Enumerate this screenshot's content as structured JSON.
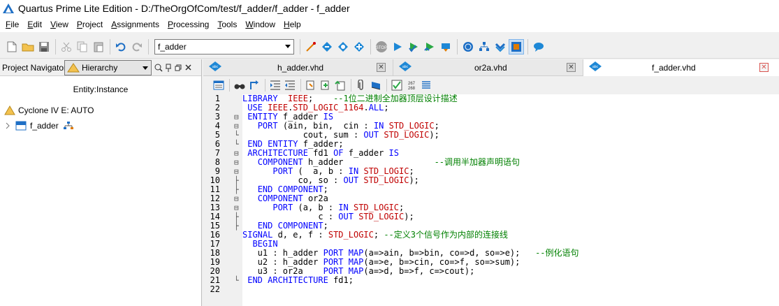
{
  "window": {
    "title": "Quartus Prime Lite Edition - D:/TheOrgOfCom/test/f_adder/f_adder - f_adder"
  },
  "menu": [
    {
      "label": "File",
      "u": "F",
      "rest": "ile"
    },
    {
      "label": "Edit",
      "u": "E",
      "rest": "dit"
    },
    {
      "label": "View",
      "u": "V",
      "rest": "iew"
    },
    {
      "label": "Project",
      "u": "P",
      "rest": "roject"
    },
    {
      "label": "Assignments",
      "u": "A",
      "rest": "ssignments"
    },
    {
      "label": "Processing",
      "u": "P",
      "rest": "rocessing"
    },
    {
      "label": "Tools",
      "u": "T",
      "rest": "ools"
    },
    {
      "label": "Window",
      "u": "W",
      "rest": "indow"
    },
    {
      "label": "Help",
      "u": "H",
      "rest": "elp"
    }
  ],
  "toolbar": {
    "entity_combo": "f_adder"
  },
  "left_panel": {
    "title": "Project Navigator",
    "view_combo": "Hierarchy",
    "column_header": "Entity:Instance",
    "device": "Cyclone IV E: AUTO",
    "entity": "f_adder",
    "entity_icon_label": "abc"
  },
  "tabs": [
    {
      "label": "h_adder.vhd",
      "icon": "abc",
      "active": false
    },
    {
      "label": "or2a.vhd",
      "icon": "abc",
      "active": false
    },
    {
      "label": "f_adder.vhd",
      "icon": "abc",
      "active": true
    }
  ],
  "editor_toolbar": {
    "line_count_label_top": "267",
    "line_count_label_bottom": "268"
  },
  "code": {
    "line_numbers": [
      "1",
      "2",
      "3",
      "4",
      "5",
      "6",
      "7",
      "8",
      "9",
      "10",
      "11",
      "12",
      "13",
      "14",
      "15",
      "16",
      "17",
      "18",
      "19",
      "20",
      "21",
      "22"
    ],
    "lines": [
      [
        {
          "t": "LIBRARY",
          "c": "kw"
        },
        {
          "t": "  "
        },
        {
          "t": "IEEE",
          "c": "ty"
        },
        {
          "t": ";    "
        },
        {
          "t": "--1位二进制全加器顶层设计描述",
          "c": "cm"
        }
      ],
      [
        {
          "t": " "
        },
        {
          "t": "USE",
          "c": "kw"
        },
        {
          "t": " "
        },
        {
          "t": "IEEE",
          "c": "ty"
        },
        {
          "t": "."
        },
        {
          "t": "STD_LOGIC_1164",
          "c": "ty"
        },
        {
          "t": "."
        },
        {
          "t": "ALL",
          "c": "kw"
        },
        {
          "t": ";"
        }
      ],
      [
        {
          "t": " "
        },
        {
          "t": "ENTITY",
          "c": "kw"
        },
        {
          "t": " f_adder "
        },
        {
          "t": "IS",
          "c": "kw"
        }
      ],
      [
        {
          "t": "   "
        },
        {
          "t": "PORT",
          "c": "kw"
        },
        {
          "t": " (ain, bin,  cin : "
        },
        {
          "t": "IN",
          "c": "kw"
        },
        {
          "t": " "
        },
        {
          "t": "STD_LOGIC",
          "c": "ty"
        },
        {
          "t": ";"
        }
      ],
      [
        {
          "t": "            cout, sum : "
        },
        {
          "t": "OUT",
          "c": "kw"
        },
        {
          "t": " "
        },
        {
          "t": "STD_LOGIC",
          "c": "ty"
        },
        {
          "t": ");"
        }
      ],
      [
        {
          "t": " "
        },
        {
          "t": "END",
          "c": "kw"
        },
        {
          "t": " "
        },
        {
          "t": "ENTITY",
          "c": "kw"
        },
        {
          "t": " f_adder;"
        }
      ],
      [
        {
          "t": " "
        },
        {
          "t": "ARCHITECTURE",
          "c": "kw"
        },
        {
          "t": " fd1 "
        },
        {
          "t": "OF",
          "c": "kw"
        },
        {
          "t": " f_adder "
        },
        {
          "t": "IS",
          "c": "kw"
        }
      ],
      [
        {
          "t": "   "
        },
        {
          "t": "COMPONENT",
          "c": "kw"
        },
        {
          "t": " h_adder                  "
        },
        {
          "t": "--调用半加器声明语句",
          "c": "cm"
        }
      ],
      [
        {
          "t": "      "
        },
        {
          "t": "PORT",
          "c": "kw"
        },
        {
          "t": " (  a, b : "
        },
        {
          "t": "IN",
          "c": "kw"
        },
        {
          "t": " "
        },
        {
          "t": "STD_LOGIC",
          "c": "ty"
        },
        {
          "t": ";"
        }
      ],
      [
        {
          "t": "           co, so : "
        },
        {
          "t": "OUT",
          "c": "kw"
        },
        {
          "t": " "
        },
        {
          "t": "STD_LOGIC",
          "c": "ty"
        },
        {
          "t": ");"
        }
      ],
      [
        {
          "t": "   "
        },
        {
          "t": "END",
          "c": "kw"
        },
        {
          "t": " "
        },
        {
          "t": "COMPONENT",
          "c": "kw"
        },
        {
          "t": ";"
        }
      ],
      [
        {
          "t": "   "
        },
        {
          "t": "COMPONENT",
          "c": "kw"
        },
        {
          "t": " or2a"
        }
      ],
      [
        {
          "t": "      "
        },
        {
          "t": "PORT",
          "c": "kw"
        },
        {
          "t": " (a, b : "
        },
        {
          "t": "IN",
          "c": "kw"
        },
        {
          "t": " "
        },
        {
          "t": "STD_LOGIC",
          "c": "ty"
        },
        {
          "t": ";"
        }
      ],
      [
        {
          "t": "               c : "
        },
        {
          "t": "OUT",
          "c": "kw"
        },
        {
          "t": " "
        },
        {
          "t": "STD_LOGIC",
          "c": "ty"
        },
        {
          "t": ");"
        }
      ],
      [
        {
          "t": "   "
        },
        {
          "t": "END",
          "c": "kw"
        },
        {
          "t": " "
        },
        {
          "t": "COMPONENT",
          "c": "kw"
        },
        {
          "t": ";"
        }
      ],
      [
        {
          "t": "SIGNAL",
          "c": "kw"
        },
        {
          "t": " d, e, f : "
        },
        {
          "t": "STD_LOGIC",
          "c": "ty"
        },
        {
          "t": "; "
        },
        {
          "t": "--定义3个信号作为内部的连接线",
          "c": "cm"
        }
      ],
      [
        {
          "t": "  "
        },
        {
          "t": "BEGIN",
          "c": "kw"
        }
      ],
      [
        {
          "t": "   u1 : h_adder "
        },
        {
          "t": "PORT",
          "c": "kw"
        },
        {
          "t": " "
        },
        {
          "t": "MAP",
          "c": "kw"
        },
        {
          "t": "(a=>ain, b=>bin, co=>d, so=>e);   "
        },
        {
          "t": "--例化语句",
          "c": "cm"
        }
      ],
      [
        {
          "t": "   u2 : h_adder "
        },
        {
          "t": "PORT",
          "c": "kw"
        },
        {
          "t": " "
        },
        {
          "t": "MAP",
          "c": "kw"
        },
        {
          "t": "(a=>e, b=>cin, co=>f, so=>sum);"
        }
      ],
      [
        {
          "t": "   u3 : or2a    "
        },
        {
          "t": "PORT",
          "c": "kw"
        },
        {
          "t": " "
        },
        {
          "t": "MAP",
          "c": "kw"
        },
        {
          "t": "(a=>d, b=>f, c=>cout);"
        }
      ],
      [
        {
          "t": " "
        },
        {
          "t": "END",
          "c": "kw"
        },
        {
          "t": " "
        },
        {
          "t": "ARCHITECTURE",
          "c": "kw"
        },
        {
          "t": " fd1;"
        }
      ],
      []
    ],
    "folds": [
      "",
      "",
      "⊟",
      "⊟",
      "└",
      "└",
      "⊟",
      "⊟",
      "⊟",
      "├",
      "├",
      "⊟",
      "⊟",
      "├",
      "├",
      "",
      "",
      "",
      "",
      "",
      "└",
      ""
    ]
  },
  "colors": {
    "keyword": "#0000ff",
    "type": "#c00000",
    "comment": "#008000"
  }
}
